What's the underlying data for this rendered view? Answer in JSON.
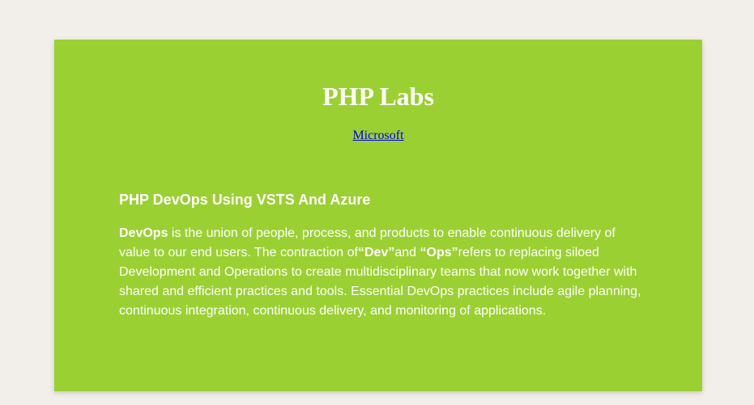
{
  "header": {
    "title": "PHP Labs",
    "link_label": "Microsoft"
  },
  "article": {
    "heading": "PHP DevOps Using VSTS And Azure",
    "term_devops": "DevOps",
    "text_1": " is the union of people, process, and products to enable continuous delivery of value to our end users. The contraction of",
    "term_dev": "“Dev”",
    "text_2": "and ",
    "term_ops": "“Ops”",
    "text_3": "refers to replacing siloed Development and Operations to create multidisciplinary teams that now work together with shared and efficient practices and tools. Essential DevOps practices include agile planning, continuous integration, continuous delivery, and monitoring of applications."
  },
  "colors": {
    "page_background": "#f2efeb",
    "card_background": "#9bd032",
    "text": "#ffffff",
    "link": "#0000ee"
  }
}
